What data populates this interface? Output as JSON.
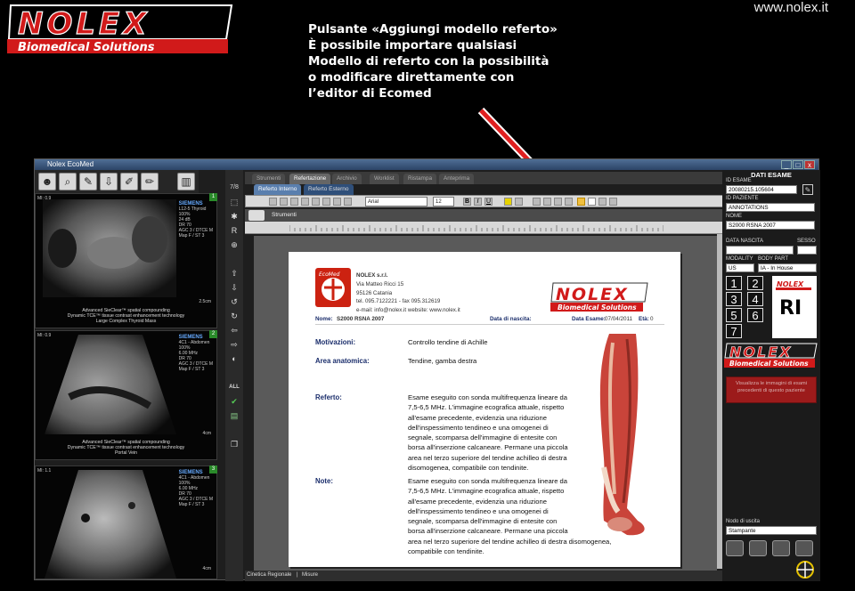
{
  "header": {
    "brand": "NOLEX",
    "brand_sub": "Biomedical Solutions",
    "website": "www.nolex.it",
    "caption_lines": [
      "Pulsante «Aggiungi modello referto»",
      "È possibile importare qualsiasi",
      "Modello di referto  con la possibilità",
      "o modificare direttamente con",
      " l’editor di Ecomed"
    ]
  },
  "colors": {
    "brand_red": "#d11a1a",
    "accent_blue": "#1a2d6b",
    "arrow": "#e02020"
  },
  "window": {
    "title": "Nolex EcoMed",
    "controls": [
      "_",
      "□",
      "x"
    ]
  },
  "thumbnails": [
    {
      "index": "1",
      "corner": "MI: 0.9",
      "vendor": "SIEMENS",
      "meta": [
        "L12-5 Thyroid",
        "100%",
        "24 dB",
        "DR 70",
        "AGC 3 / DTCE M",
        "Map F / ST 3"
      ],
      "caption": [
        "Advanced SieClear™ spatial compounding",
        "Dynamic TCE™ tissue contrast enhancement technology",
        "Large Complex Thyroid Mass"
      ],
      "depth": "2.5cm"
    },
    {
      "index": "2",
      "corner": "MI: 0.9",
      "vendor": "SIEMENS",
      "meta": [
        "4C1 - Abdomen",
        "100%",
        "6.00 MHz",
        "DR 70",
        "AGC 3 / DTCE M",
        "Map F / ST 3"
      ],
      "caption": [
        "Advanced SieClear™ spatial compounding",
        "Dynamic TCE™ tissue contrast enhancement technology",
        "Portal Vein"
      ],
      "depth": "4cm"
    },
    {
      "index": "3",
      "corner": "MI: 1.1",
      "vendor": "SIEMENS",
      "meta": [
        "4C1 - Abdomen",
        "100%",
        "6.00 MHz",
        "DR 70",
        "AGC 3 / DTCE M",
        "Map F / ST 3"
      ],
      "caption": [],
      "depth": "4cm"
    }
  ],
  "side_label": "7/8",
  "side_tools": [
    "select-icon",
    "magnify-icon",
    "move-icon",
    "rotate-icon",
    "all-label"
  ],
  "side_all": "ALL",
  "side_r": "R",
  "tabs": [
    "Strumenti",
    "Refertazione",
    "Archivio",
    "Worklist",
    "Ristampa",
    "Anteprima"
  ],
  "active_tab": "Refertazione",
  "subtabs": [
    "Referto Interno",
    "Referto Esterno"
  ],
  "format": {
    "font": "Arial",
    "size": "12"
  },
  "strumenti_label": "Strumenti",
  "document": {
    "company": [
      "NOLEX s.r.l.",
      "Via Matteo Ricci 15",
      "95126 Catania",
      "tel. 095.7122221 - fax  095.312619",
      "e-mail: info@nolex.it  website: www.nolex.it"
    ],
    "ecomed_logo": "EcoMed",
    "doc_brand": "NOLEX",
    "doc_brand_sub": "Biomedical Solutions",
    "patient_line": {
      "nome_label": "Nome:",
      "nome": "S2000 RSNA 2007",
      "nascita_label": "Data di nascita:",
      "esame_label": "Data Esame:",
      "esame": "07/04/2011",
      "eta_label": "Età:",
      "eta": "0"
    },
    "motivazioni_label": "Motivazioni:",
    "motivazioni": "Controllo tendine di Achille",
    "area_label": "Area anatomica:",
    "area": "Tendine, gamba destra",
    "referto_label": "Referto:",
    "referto_lines": [
      "Esame eseguito con sonda multifrequenza lineare da",
      "7,5-6,5 MHz. L'immagine ecografica attuale, rispetto",
      "all'esame precedente, evidenzia una riduzione",
      "dell'inspessimento tendineo e una omogenei di",
      "segnale, scomparsa dell'immagine di entesite con",
      "borsa all'inserzione calcaneare. Permane una piccola",
      "area nel terzo superiore del tendine achilleo di destra",
      "disomogenea, compatibile con tendinite."
    ],
    "note_label": "Note:",
    "note_lines": [
      "Esame eseguito con sonda multifrequenza lineare da",
      "7,5-6,5 MHz. L'immagine ecografica attuale, rispetto",
      "all'esame precedente, evidenzia una riduzione",
      "dell'inspessimento tendineo e una omogenei di",
      "segnale, scomparsa dell'immagine di entesite con",
      "borsa all'inserzione calcaneare. Permane una piccola",
      "area nel terzo superiore del tendine achilleo di destra disomogenea,",
      "compatibile con tendinite."
    ]
  },
  "statusbar": [
    "Cinetica Regionale",
    "Misure"
  ],
  "right_panel": {
    "title": "DATI ESAME",
    "id_esame_label": "ID ESAME",
    "id_esame": "20080215.105604",
    "id_paziente_label": "ID PAZIENTE",
    "id_paziente": "ANNOTATIONS",
    "nome_label": "NOME",
    "nome": "S2000 RSNA 2007",
    "nascita_label": "DATA NASCITA",
    "sesso_label": "SESSO",
    "modality_label": "MODALITY",
    "modality": "US",
    "body_part_label": "BODY PART",
    "body_part": "IA - In House",
    "layout_nums": [
      "1",
      "2",
      "3",
      "4",
      "5",
      "6",
      "7"
    ],
    "ri": "RI",
    "mini_brand": "NOLEX",
    "mini_brand_sub": "Biomedical Solutions",
    "red_button": "Visualizza le immagini di esami precedenti di questo paziente",
    "nodo_label": "Nodo di uscita",
    "nodo_value": "Stampante"
  }
}
